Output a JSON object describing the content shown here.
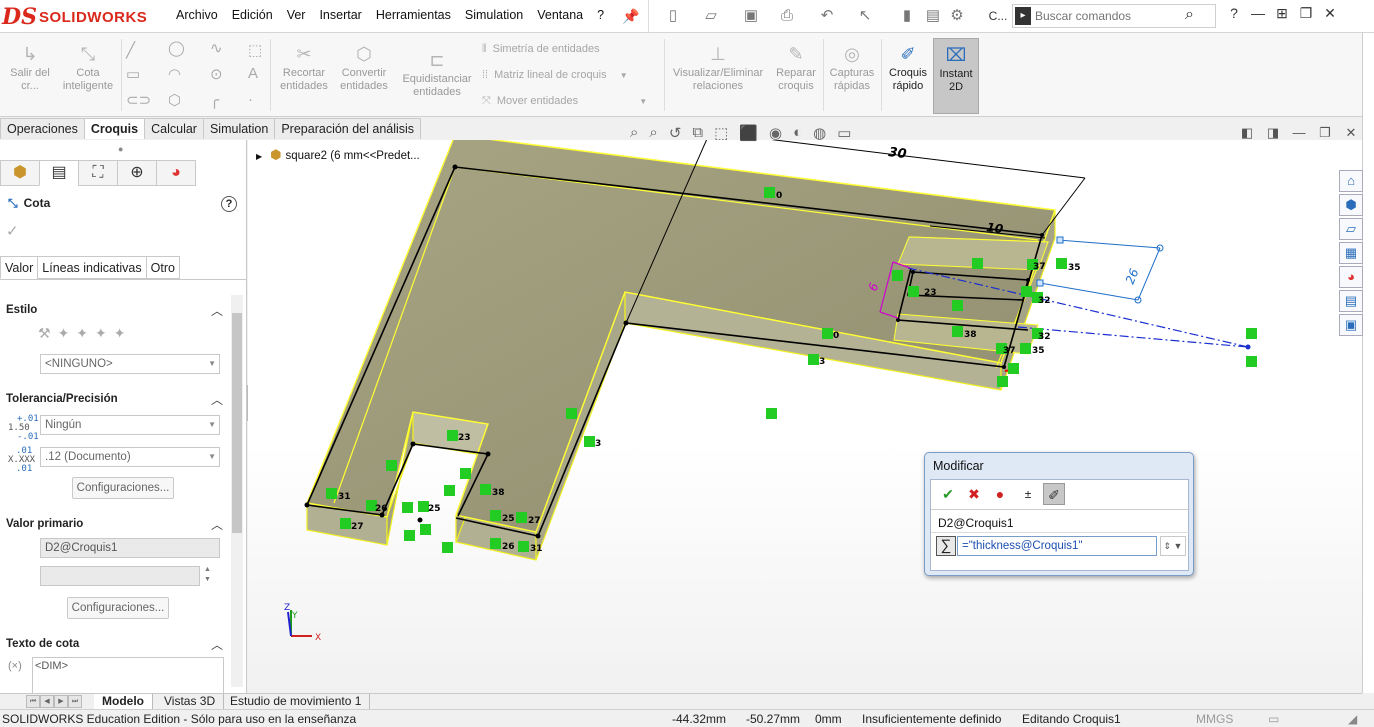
{
  "app": {
    "logo_ds": "DS",
    "logo_name": "SOLIDWORKS"
  },
  "menu": [
    "Archivo",
    "Edición",
    "Ver",
    "Insertar",
    "Herramientas",
    "Simulation",
    "Ventana",
    "?"
  ],
  "quick_access": {
    "truncated_label": "C..."
  },
  "command_search": {
    "placeholder": "Buscar comandos"
  },
  "ribbon": {
    "salir": "Salir del cr...",
    "cota_inteligente": "Cota inteligente",
    "recortar": "Recortar entidades",
    "convertir": "Convertir entidades",
    "equidistanciar": "Equidistanciar entidades",
    "simetria": "Simetría de entidades",
    "matriz": "Matriz lineal de croquis",
    "mover": "Mover entidades",
    "visualizar": "Visualizar/Eliminar relaciones",
    "reparar": "Reparar croquis",
    "capturas": "Capturas rápidas",
    "croquis_rapido": "Croquis rápido",
    "instant2d": "Instant 2D"
  },
  "cm_tabs": [
    "Operaciones",
    "Croquis",
    "Calcular",
    "Simulation",
    "Preparación del análisis"
  ],
  "cm_tab_selected": 1,
  "property_manager": {
    "title": "Cota",
    "tabs": [
      "Valor",
      "Líneas indicativas",
      "Otro"
    ],
    "estilo": {
      "title": "Estilo",
      "dropdown": "<NINGUNO>"
    },
    "tolerancia": {
      "title": "Tolerancia/Precisión",
      "tol_icon": [
        "+.01",
        "1.50",
        "-.01"
      ],
      "prec_icon": [
        ".01",
        "X.XXX",
        ".01"
      ],
      "tolerance": "Ningún",
      "precision": ".12 (Documento)",
      "button": "Configuraciones..."
    },
    "valor_primario": {
      "title": "Valor primario",
      "name": "D2@Croquis1",
      "value": "",
      "button": "Configuraciones..."
    },
    "texto_cota": {
      "title": "Texto de cota",
      "text": "<DIM>"
    }
  },
  "feature_tree": {
    "item": "square2  (6 mm<<Predet..."
  },
  "graphics": {
    "dims": {
      "d30": "30",
      "d10": "10",
      "d26": "26",
      "d6": "6"
    },
    "relation_numbers": [
      "0",
      "0",
      "3",
      "3",
      "23",
      "23",
      "25",
      "25",
      "26",
      "26",
      "27",
      "27",
      "31",
      "31",
      "32",
      "32",
      "35",
      "35",
      "37",
      "37",
      "38",
      "38"
    ],
    "triad": {
      "x": "X",
      "y": "Y",
      "z": "Z"
    }
  },
  "modify_dialog": {
    "title": "Modificar",
    "dim_name": "D2@Croquis1",
    "value": "=\"thickness@Croquis1\""
  },
  "bottom_tabs": [
    "Modelo",
    "Vistas 3D",
    "Estudio de movimiento 1"
  ],
  "status": {
    "edition": "SOLIDWORKS Education Edition - Sólo para uso en la enseñanza",
    "x": "-44.32mm",
    "y": "-50.27mm",
    "z": "0mm",
    "state": "Insuficientemente definido",
    "editing": "Editando Croquis1",
    "units": "MMGS"
  },
  "colors": {
    "brand": "#da291c",
    "model_face": "#9c9a78",
    "model_edge": "#ffff33",
    "relation": "#22cc44",
    "sketch": "#000000",
    "dimension": "#1f6fc8",
    "selected_dim": "#d000d0"
  }
}
